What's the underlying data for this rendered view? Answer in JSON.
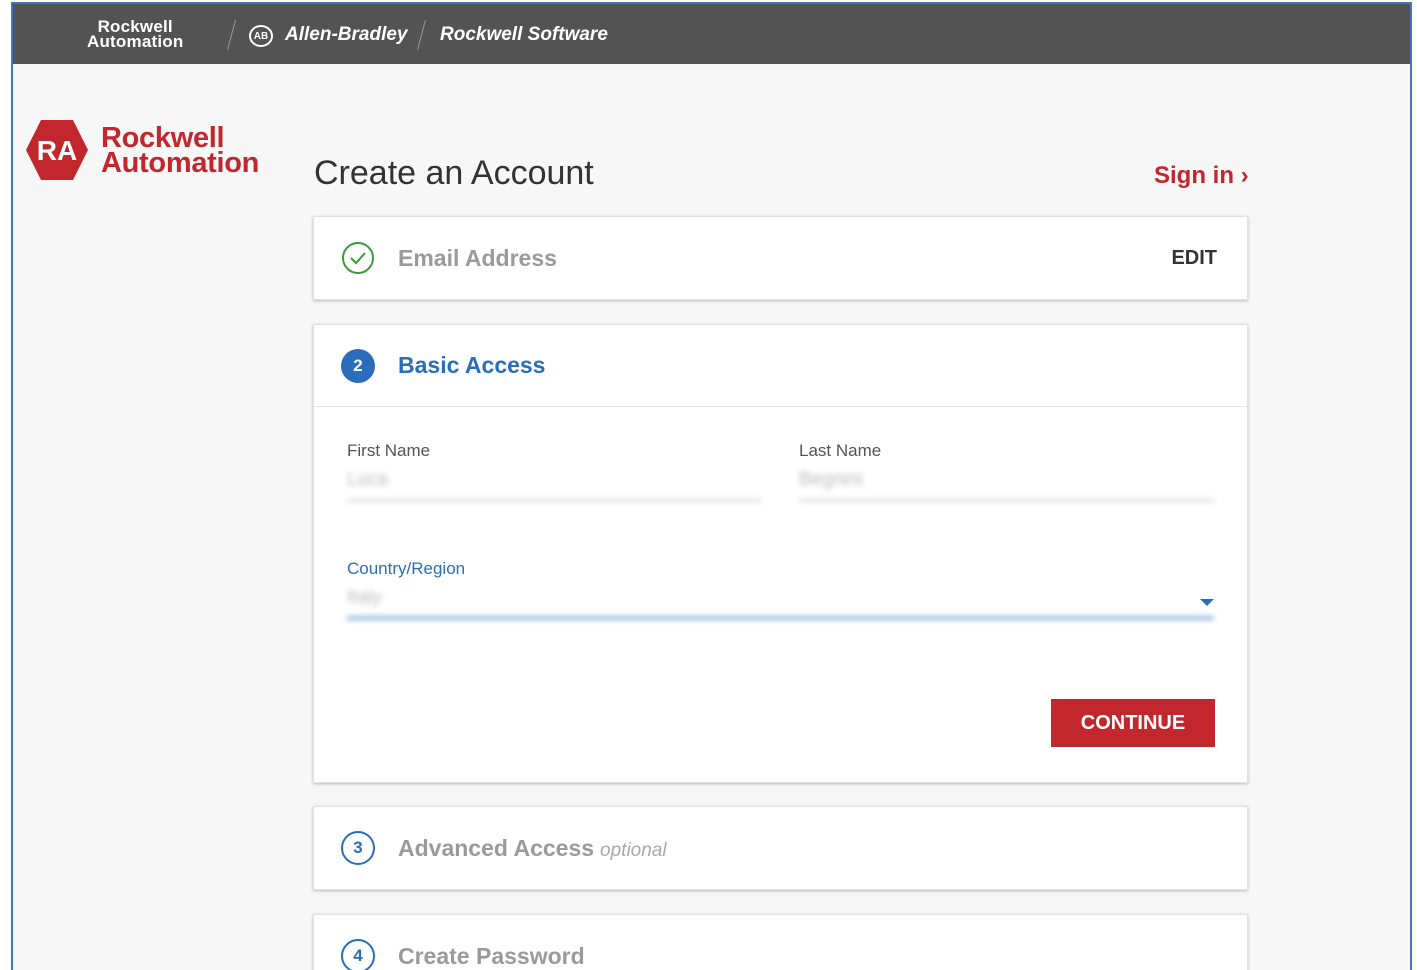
{
  "topbar": {
    "brand_line1": "Rockwell",
    "brand_line2": "Automation",
    "ab_mark": "AB",
    "allen_bradley": "Allen-Bradley",
    "rockwell_software": "Rockwell Software"
  },
  "logo": {
    "mark": "RA",
    "line1": "Rockwell",
    "line2": "Automation"
  },
  "header": {
    "title": "Create an Account",
    "signin_label": "Sign in ›"
  },
  "steps": {
    "email": {
      "title": "Email Address",
      "action": "EDIT",
      "status": "complete"
    },
    "basic": {
      "number": "2",
      "title": "Basic Access",
      "status": "active"
    },
    "advanced": {
      "number": "3",
      "title": "Advanced Access",
      "note": "optional"
    },
    "password": {
      "number": "4",
      "title": "Create Password"
    }
  },
  "form": {
    "first_name_label": "First Name",
    "first_name_value": "Luca",
    "last_name_label": "Last Name",
    "last_name_value": "Begnini",
    "country_label": "Country/Region",
    "country_value": "Italy",
    "continue_label": "CONTINUE"
  },
  "colors": {
    "brand_red": "#c1272d",
    "accent_blue": "#2a6ebb",
    "success_green": "#3c9a3c",
    "topbar": "#535353"
  }
}
